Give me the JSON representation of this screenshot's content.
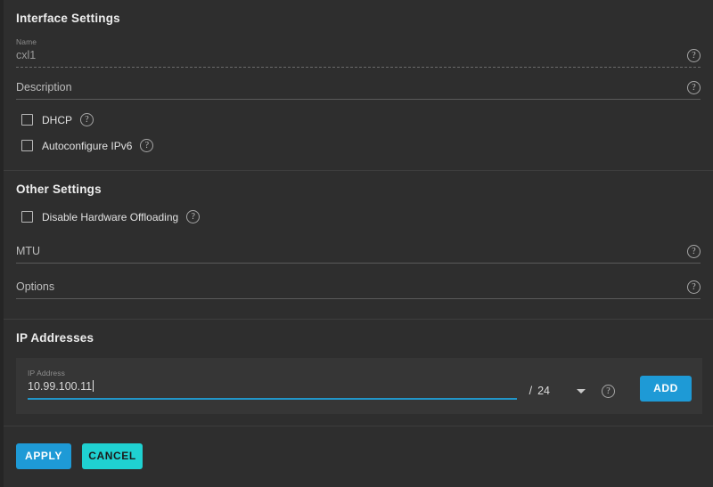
{
  "interface_settings": {
    "title": "Interface Settings",
    "name_field": {
      "label": "Name",
      "value": "cxl1",
      "help": "?"
    },
    "description_field": {
      "label": "Description",
      "value": "",
      "help": "?"
    },
    "dhcp_checkbox": {
      "label": "DHCP",
      "checked": false,
      "help": "?"
    },
    "autoconfigure_ipv6_checkbox": {
      "label": "Autoconfigure IPv6",
      "checked": false,
      "help": "?"
    }
  },
  "other_settings": {
    "title": "Other Settings",
    "disable_hardware_offloading_checkbox": {
      "label": "Disable Hardware Offloading",
      "checked": false,
      "help": "?"
    },
    "mtu_field": {
      "label": "MTU",
      "value": "",
      "help": "?"
    },
    "options_field": {
      "label": "Options",
      "value": "",
      "help": "?"
    }
  },
  "ip_addresses": {
    "title": "IP Addresses",
    "row": {
      "label": "IP Address",
      "value": "10.99.100.11",
      "separator": "/",
      "netmask": "24",
      "netmask_caret": "chevron-down-icon",
      "help": "?",
      "add_label": "ADD"
    }
  },
  "actions": {
    "apply_label": "APPLY",
    "cancel_label": "CANCEL"
  },
  "colors": {
    "accent_blue": "#1e9ad6",
    "accent_cyan": "#1fd1d1",
    "focus_underline": "#2196c9",
    "panel_bg": "#2e2e2e",
    "card_bg": "#363636"
  }
}
